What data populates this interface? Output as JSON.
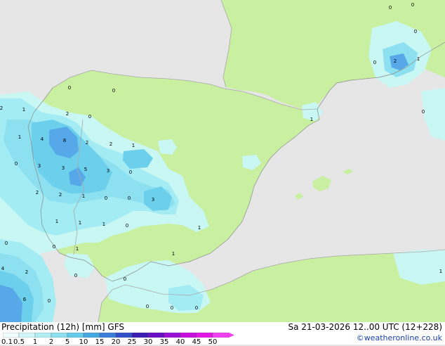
{
  "title": "Precipitation (12h) [mm] GFS",
  "datetime": "Sa 21-03-2026 12..00 UTC (12+228)",
  "credit": "©weatheronline.co.uk",
  "colors": {
    "sea": "#e6e6e6",
    "land": "#c8f0a0",
    "p01": "#c8f7f4",
    "p05": "#a4ecf4",
    "p1": "#8ce0f0",
    "p2": "#6ccfec",
    "p5": "#56a8e8",
    "border": "#a8a8a8"
  },
  "colorbar": {
    "labels": [
      "0.1",
      "0.5",
      "1",
      "2",
      "5",
      "10",
      "15",
      "20",
      "25",
      "30",
      "35",
      "40",
      "45",
      "50"
    ],
    "colors": [
      "#f0fefe",
      "#d0f6f8",
      "#b0eef4",
      "#8ce0f0",
      "#64cbeb",
      "#46a8e0",
      "#3a7ed8",
      "#3050c8",
      "#3a1eb4",
      "#6a10c4",
      "#9a10d4",
      "#c810dc",
      "#e418e4",
      "#f040f0"
    ]
  },
  "map_labels": [
    "0",
    "0",
    "0",
    "0",
    "2",
    "1",
    "0",
    "0",
    "2",
    "2",
    "1",
    "0",
    "1",
    "4",
    "8",
    "2",
    "2",
    "1",
    "0",
    "3",
    "3",
    "5",
    "3",
    "0",
    "0",
    "2",
    "2",
    "1",
    "0",
    "3",
    "0",
    "1",
    "1",
    "1",
    "0",
    "1",
    "0",
    "1",
    "1",
    "0",
    "4",
    "2",
    "0",
    "0",
    "0",
    "0",
    "0",
    "6",
    "0",
    "1",
    "1"
  ]
}
